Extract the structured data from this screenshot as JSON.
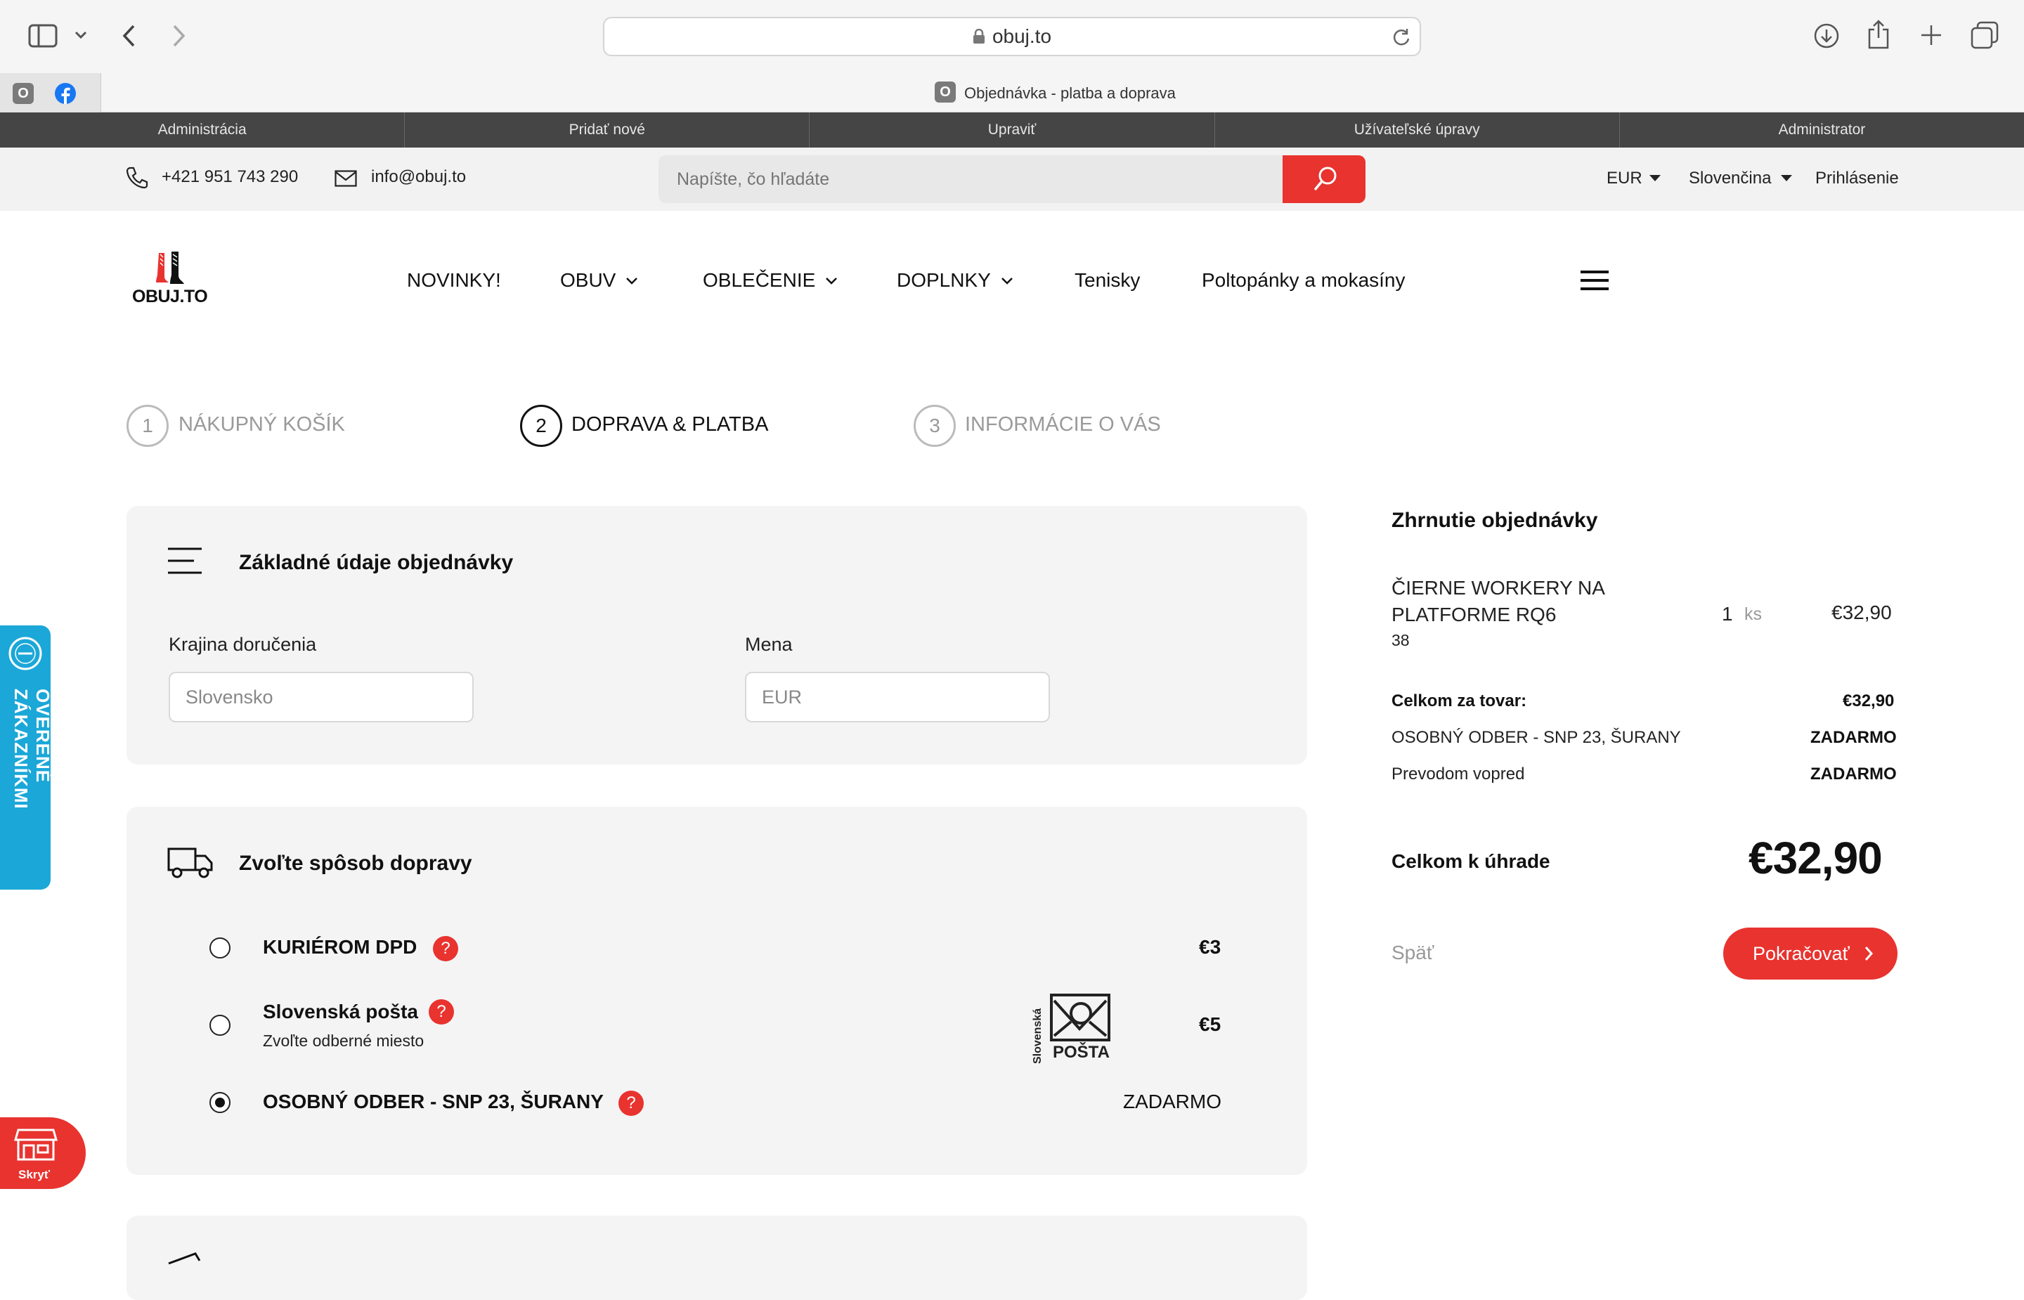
{
  "browser": {
    "url": "obuj.to",
    "tab_title": "Objednávka - platba a doprava",
    "tab_favicon_letter": "O",
    "pinned_favicon_letter": "O"
  },
  "admin_bar": [
    "Administrácia",
    "Pridať nové",
    "Upraviť",
    "Užívateľské úpravy",
    "Administrator"
  ],
  "top_info": {
    "phone": "+421 951 743 290",
    "email": "info@obuj.to",
    "search_placeholder": "Napíšte, čo hľadáte",
    "currency": "EUR",
    "language": "Slovenčina",
    "login": "Prihlásenie"
  },
  "logo_text": "OBUJ.TO",
  "nav": {
    "novinky": "NOVINKY!",
    "obuv": "OBUV",
    "oblecenie": "OBLEČENIE",
    "doplnky": "DOPLNKY",
    "tenisky": "Tenisky",
    "poltopanky": "Poltopánky a mokasíny"
  },
  "steps": [
    {
      "num": "1",
      "label": "NÁKUPNÝ KOŠÍK"
    },
    {
      "num": "2",
      "label": "DOPRAVA & PLATBA"
    },
    {
      "num": "3",
      "label": "INFORMÁCIE O VÁS"
    }
  ],
  "basic_panel": {
    "title": "Základné údaje objednávky",
    "country_label": "Krajina doručenia",
    "country_value": "Slovensko",
    "currency_label": "Mena",
    "currency_value": "EUR"
  },
  "shipping_panel": {
    "title": "Zvoľte spôsob dopravy",
    "options": [
      {
        "name": "KURIÉROM DPD",
        "price": "€3",
        "selected": false
      },
      {
        "name": "Slovenská pošta",
        "sub": "Zvoľte odberné miesto",
        "price": "€5",
        "selected": false
      },
      {
        "name": "OSOBNÝ ODBER - SNP 23, ŠURANY",
        "price": "ZADARMO",
        "selected": true
      }
    ],
    "help_mark": "?",
    "posta_logo_side": "Slovenská",
    "posta_logo_text": "POŠTA"
  },
  "summary": {
    "title": "Zhrnutie objednávky",
    "item_line1": "ČIERNE WORKERY NA",
    "item_line2": "PLATFORME RQ6",
    "item_size": "38",
    "item_qty": "1",
    "item_unit": "ks",
    "item_price": "€32,90",
    "goods_label": "Celkom za tovar:",
    "goods_value": "€32,90",
    "shipping_label": "OSOBNÝ ODBER - SNP 23, ŠURANY",
    "shipping_value": "ZADARMO",
    "payment_label": "Prevodom vopred",
    "payment_value": "ZADARMO",
    "total_label": "Celkom k úhrade",
    "total_value": "€32,90",
    "back": "Späť",
    "continue": "Pokračovať"
  },
  "badge_text": "OVERENÉ ZÁKAZNÍKMI",
  "hide_label": "Skryť",
  "colors": {
    "accent": "#e8332f",
    "badge": "#1ba7d8",
    "admin_bar": "#454545"
  }
}
